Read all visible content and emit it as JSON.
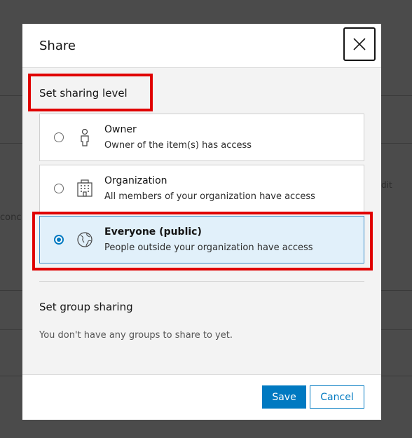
{
  "dialog": {
    "title": "Share",
    "close_icon": "close-icon"
  },
  "background": {
    "fragments": [
      "conc",
      "dit"
    ]
  },
  "sharing_level": {
    "heading": "Set sharing level",
    "options": [
      {
        "id": "owner",
        "icon": "person-icon",
        "title": "Owner",
        "description": "Owner of the item(s) has access",
        "selected": false
      },
      {
        "id": "organization",
        "icon": "building-icon",
        "title": "Organization",
        "description": "All members of your organization have access",
        "selected": false
      },
      {
        "id": "everyone",
        "icon": "globe-icon",
        "title": "Everyone (public)",
        "description": "People outside your organization have access",
        "selected": true
      }
    ]
  },
  "group_sharing": {
    "heading": "Set group sharing",
    "empty_message": "You don't have any groups to share to yet."
  },
  "footer": {
    "save_label": "Save",
    "cancel_label": "Cancel"
  },
  "colors": {
    "accent": "#0079c1",
    "highlight": "#e00000",
    "selected_bg": "#e1f0fa"
  }
}
